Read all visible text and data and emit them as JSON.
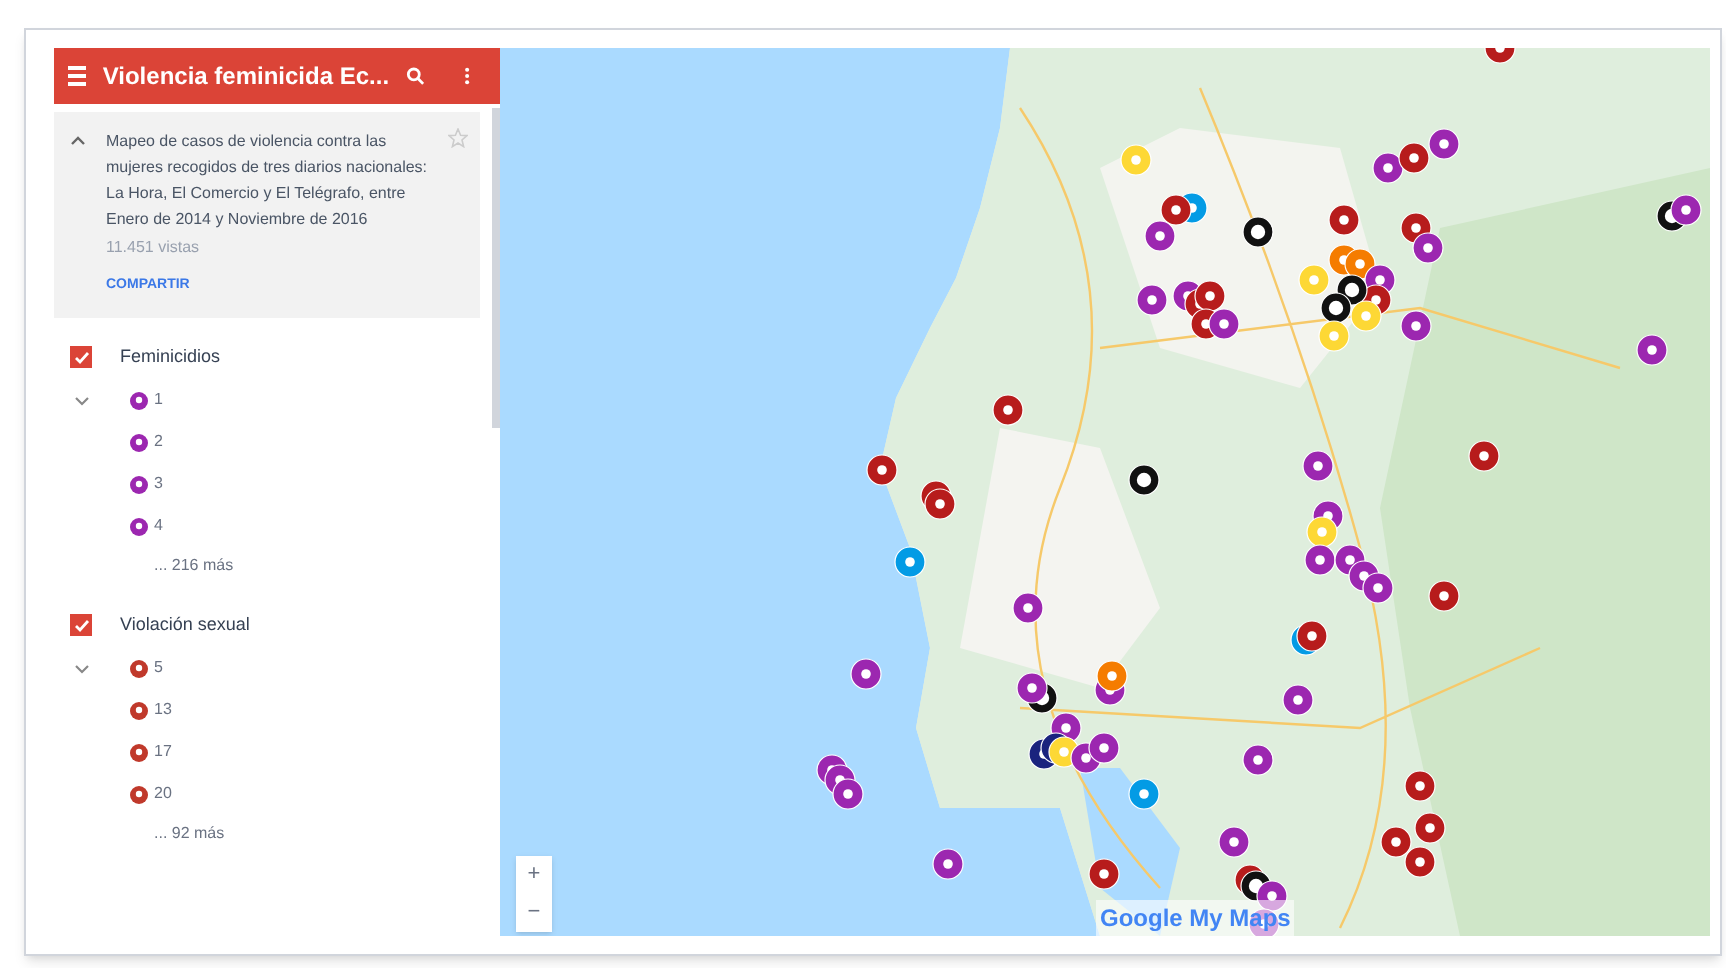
{
  "header": {
    "title": "Violencia feminicida Ec..."
  },
  "description": {
    "expanded": true,
    "text": "Mapeo de casos de violencia contra las mujeres recogidos de tres diarios nacionales: La Hora, El Comercio y El Telégrafo, entre Enero de 2014 y Noviembre de 2016",
    "views": "11.451 vistas",
    "share": "COMPARTIR",
    "starred": false
  },
  "layers": [
    {
      "name": "Feminicidios",
      "checked": true,
      "expanded": true,
      "color": "#9c27b0",
      "items": [
        "1",
        "2",
        "3",
        "4"
      ],
      "more": "... 216 más"
    },
    {
      "name": "Violación sexual",
      "checked": true,
      "expanded": true,
      "color": "#c0392b",
      "items": [
        "5",
        "13",
        "17",
        "20"
      ],
      "more": "... 92 más"
    }
  ],
  "map": {
    "zoom_in": "+",
    "zoom_out": "−",
    "logo": "Google My Maps"
  }
}
